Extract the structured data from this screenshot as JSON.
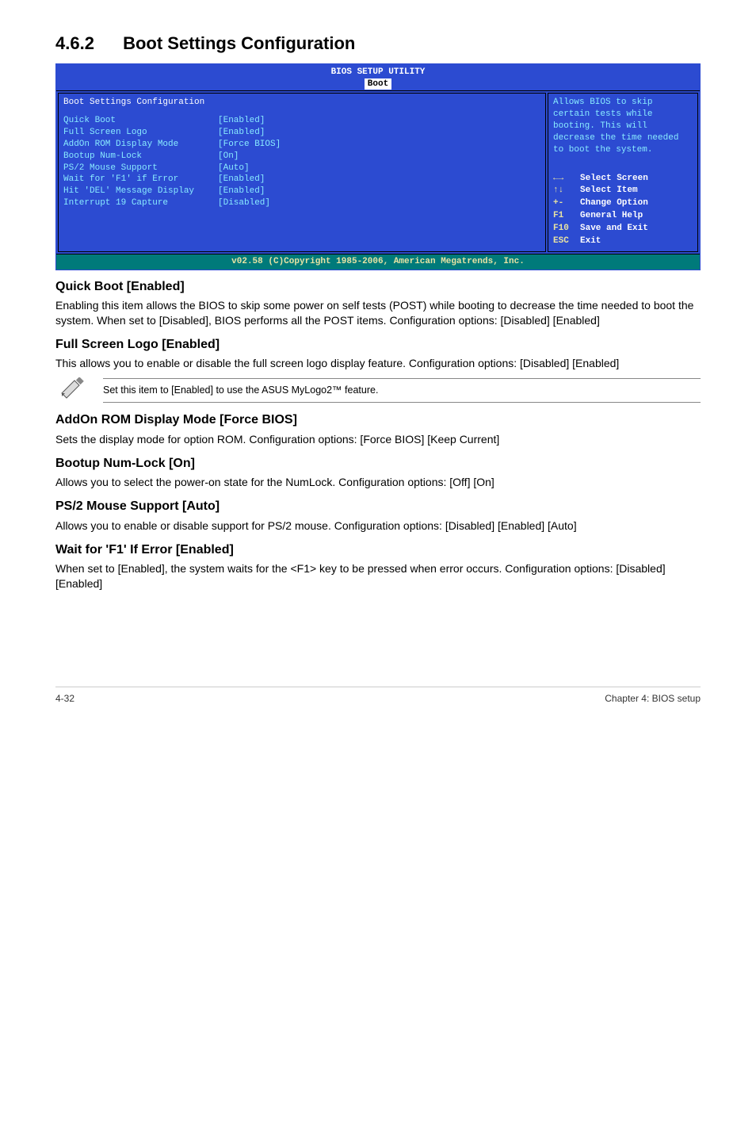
{
  "section": {
    "number": "4.6.2",
    "title": "Boot Settings Configuration"
  },
  "bios": {
    "header_line1": "BIOS SETUP UTILITY",
    "tab": "Boot",
    "left_title": "Boot Settings Configuration",
    "rows": [
      {
        "label": "Quick Boot",
        "value": "[Enabled]"
      },
      {
        "label": "Full Screen Logo",
        "value": "[Enabled]"
      },
      {
        "label": "AddOn ROM Display Mode",
        "value": "[Force BIOS]"
      },
      {
        "label": "Bootup Num-Lock",
        "value": "[On]"
      },
      {
        "label": "PS/2 Mouse Support",
        "value": "[Auto]"
      },
      {
        "label": "Wait for 'F1' if Error",
        "value": "[Enabled]"
      },
      {
        "label": "Hit 'DEL' Message Display",
        "value": "[Enabled]"
      },
      {
        "label": "Interrupt 19 Capture",
        "value": "[Disabled]"
      }
    ],
    "help_top": "Allows BIOS to skip certain tests while booting. This will decrease the time needed to boot the system.",
    "help_keys": [
      {
        "sym": "←→",
        "txt": "Select Screen"
      },
      {
        "sym": "↑↓",
        "txt": "Select Item"
      },
      {
        "sym": "+-",
        "txt": "Change Option"
      },
      {
        "sym": "F1",
        "txt": "General Help"
      },
      {
        "sym": "F10",
        "txt": "Save and Exit"
      },
      {
        "sym": "ESC",
        "txt": "Exit"
      }
    ],
    "footer": "v02.58 (C)Copyright 1985-2006, American Megatrends, Inc."
  },
  "quick_boot": {
    "heading": "Quick Boot [Enabled]",
    "body": "Enabling this item allows the BIOS to skip some power on self tests (POST) while booting to decrease the time needed to boot the system. When set to [Disabled], BIOS performs all the POST items. Configuration options: [Disabled] [Enabled]"
  },
  "full_screen_logo": {
    "heading": "Full Screen Logo [Enabled]",
    "body": "This allows you to enable or disable the full screen logo display feature. Configuration options: [Disabled] [Enabled]"
  },
  "note": "Set this item to [Enabled] to use the ASUS MyLogo2™ feature.",
  "addon_rom": {
    "heading": "AddOn ROM Display Mode [Force BIOS]",
    "body": "Sets the display mode for option ROM. Configuration options: [Force BIOS] [Keep Current]"
  },
  "bootup_numlock": {
    "heading": "Bootup Num-Lock [On]",
    "body": "Allows you to select the power-on state for the NumLock. Configuration options: [Off] [On]"
  },
  "ps2_mouse": {
    "heading": "PS/2 Mouse Support [Auto]",
    "body": "Allows you to enable or disable support for PS/2 mouse. Configuration options: [Disabled] [Enabled] [Auto]"
  },
  "wait_f1": {
    "heading": "Wait for 'F1' If Error [Enabled]",
    "body": "When set to [Enabled], the system waits for the <F1> key to be pressed when error occurs. Configuration options: [Disabled] [Enabled]"
  },
  "footer": {
    "left": "4-32",
    "right": "Chapter 4: BIOS setup"
  }
}
